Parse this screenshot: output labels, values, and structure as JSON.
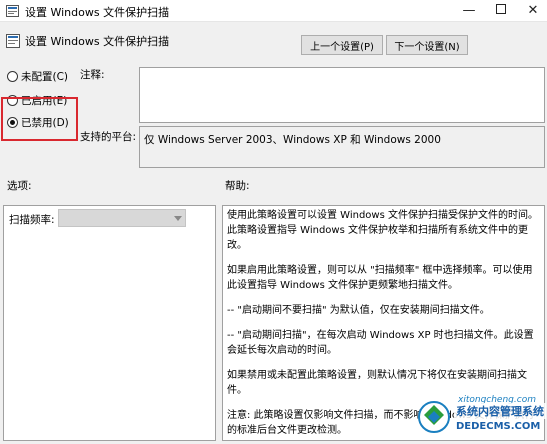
{
  "window": {
    "title": "设置 Windows 文件保护扫描",
    "minimize_glyph": "—",
    "close_glyph": "✕"
  },
  "header": {
    "title": "设置 Windows 文件保护扫描",
    "prev_button": "上一个设置(P)",
    "next_button": "下一个设置(N)"
  },
  "state": {
    "options": [
      {
        "label": "未配置(C)",
        "checked": false
      },
      {
        "label": "已启用(E)",
        "checked": false
      },
      {
        "label": "已禁用(D)",
        "checked": true
      }
    ]
  },
  "labels": {
    "comment": "注释:",
    "platform": "支持的平台:",
    "options": "选项:",
    "help": "帮助:"
  },
  "comment_value": "",
  "platform_value": "仅 Windows Server 2003、Windows XP 和 Windows 2000",
  "options_pane": {
    "scan_freq_label": "扫描频率:",
    "scan_freq_value": ""
  },
  "help": {
    "paragraphs": [
      "使用此策略设置可以设置 Windows 文件保护扫描受保护文件的时间。此策略设置指导 Windows 文件保护枚举和扫描所有系统文件中的更改。",
      "如果启用此策略设置，则可以从 \"扫描频率\" 框中选择频率。可以使用此设置指导 Windows 文件保护更频繁地扫描文件。",
      "-- \"启动期间不要扫描\" 为默认值，仅在安装期间扫描文件。",
      "-- \"启动期间扫描\"，在每次启动 Windows XP 时也扫描文件。此设置会延长每次启动的时间。",
      "如果禁用或未配置此策略设置，则默认情况下将仅在安装期间扫描文件。",
      "注意: 此策略设置仅影响文件扫描，而不影响 Windows 文件保护执行的标准后台文件更改检测。"
    ]
  },
  "watermark": {
    "line1": "系统内容管理系统",
    "line2": "DEDECMS.COM",
    "line3": "xitongcheng.com"
  },
  "colors": {
    "highlight_box": "#d9282f",
    "watermark_blue": "#1a5fa8"
  }
}
